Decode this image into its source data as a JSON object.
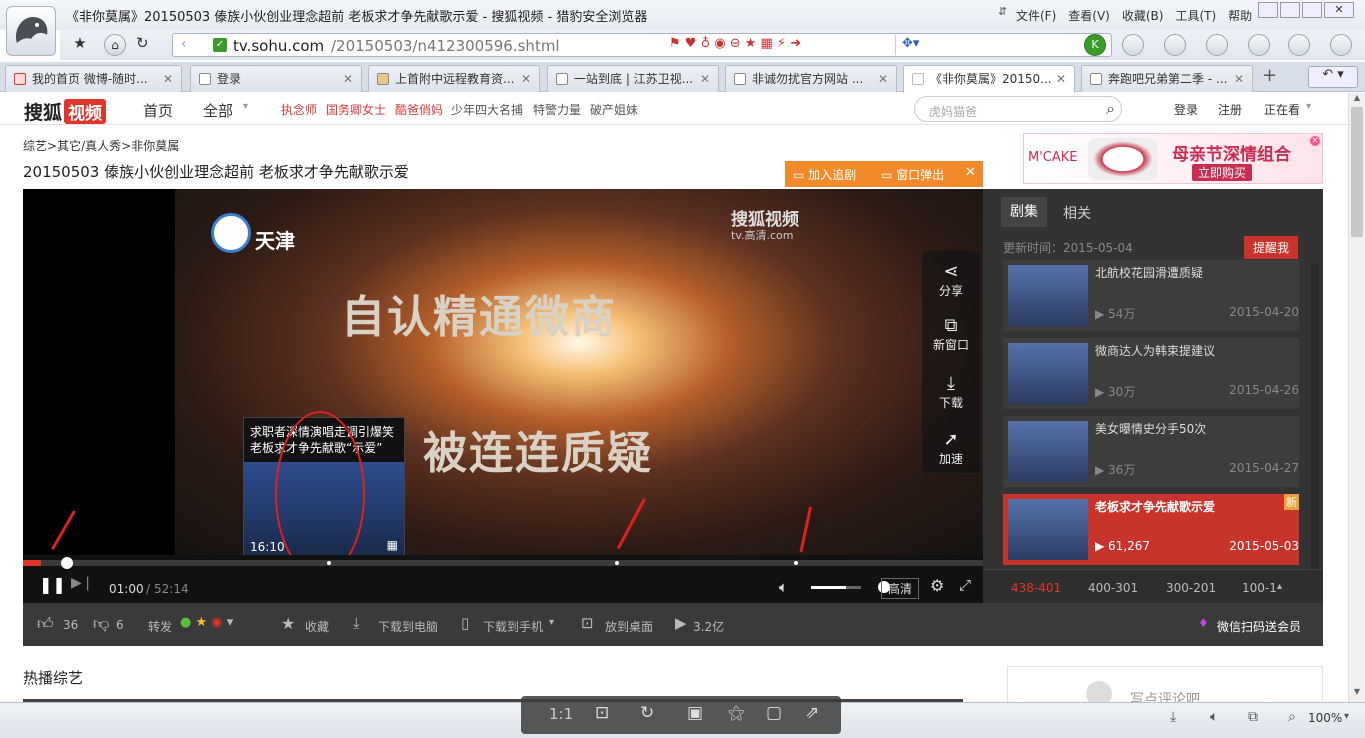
{
  "browser": {
    "window_title": "《非你莫属》20150503 傣族小伙创业理念超前 老板求才争先献歌示爱 - 搜狐视频 - 猎豹安全浏览器",
    "menu": [
      "文件(F)",
      "查看(V)",
      "收藏(B)",
      "工具(T)",
      "帮助"
    ],
    "address_domain": "tv.sohu.com",
    "address_path": "/20150503/n412300596.shtml",
    "tabs": [
      {
        "label": "我的首页 微博-随时..."
      },
      {
        "label": "登录"
      },
      {
        "label": "上首附中远程教育资..."
      },
      {
        "label": "一站到底 | 江苏卫视..."
      },
      {
        "label": "非诚勿扰官方网站 ..."
      },
      {
        "label": "《非你莫属》20150..."
      },
      {
        "label": "奔跑吧兄弟第二季 - ..."
      }
    ],
    "status_zoom": "100%"
  },
  "site": {
    "logo_text": "搜狐",
    "logo_badge": "视频",
    "nav_home": "首页",
    "nav_all": "全部",
    "hot_links": [
      "执念师",
      "国务卿女士",
      "酷爸俏妈"
    ],
    "plain_links": [
      "少年四大名捕",
      "特警力量",
      "破产姐妹"
    ],
    "search_placeholder": "虎妈猫爸",
    "login": "登录",
    "register": "注册",
    "watching": "正在看"
  },
  "page": {
    "breadcrumb": [
      "综艺",
      "其它/真人秀",
      "非你莫属"
    ],
    "title": "20150503 傣族小伙创业理念超前 老板求才争先献歌示爱",
    "add_follow": "加入追剧",
    "popout": "窗口弹出",
    "ad_brand": "M'CAKE",
    "ad_text": "母亲节深情组合",
    "ad_button": "立即购买"
  },
  "player": {
    "watermark_brand": "搜狐视频",
    "watermark_sub": "tv.高清.com",
    "station": "天津",
    "caption_line1": "自认精通微商",
    "caption_line2": "被连连质疑",
    "preview_line1": "求职者深情演唱走调引爆笑",
    "preview_line2": "老板求才争先献歌“示爱”",
    "preview_time": "16:10",
    "time_current": "01:00",
    "time_total": "52:14",
    "quality": "高清",
    "progress": 0.019,
    "volume": 0.7,
    "side_tools": [
      "分享",
      "新窗口",
      "下载",
      "加速"
    ]
  },
  "episodes": {
    "tab_episodes": "剧集",
    "tab_related": "相关",
    "updated": "更新时间：2015-05-04",
    "remind": "提醒我",
    "items": [
      {
        "title": "北航校花园滑遭质疑",
        "views": "54万",
        "date": "2015-04-20"
      },
      {
        "title": "微商达人为韩束提建议",
        "views": "30万",
        "date": "2015-04-26"
      },
      {
        "title": "美女曝情史分手50次",
        "views": "36万",
        "date": "2015-04-27"
      },
      {
        "title": "老板求才争先献歌示爱",
        "views": "61,267",
        "date": "2015-05-03",
        "badge": "新"
      }
    ],
    "pages": [
      "438-401",
      "400-301",
      "300-201",
      "100-1"
    ]
  },
  "actions": {
    "likes": "36",
    "dislikes": "6",
    "share": "转发",
    "favorite": "收藏",
    "download_pc": "下载到电脑",
    "download_phone": "下载到手机",
    "desktop": "放到桌面",
    "plays": "3.2亿",
    "vip": "微信扫码送会员"
  },
  "sections": {
    "hot_variety": "热播综艺",
    "comment_placeholder": "写点评论吧"
  },
  "image_toolbar": {
    "ratio": "1:1"
  }
}
